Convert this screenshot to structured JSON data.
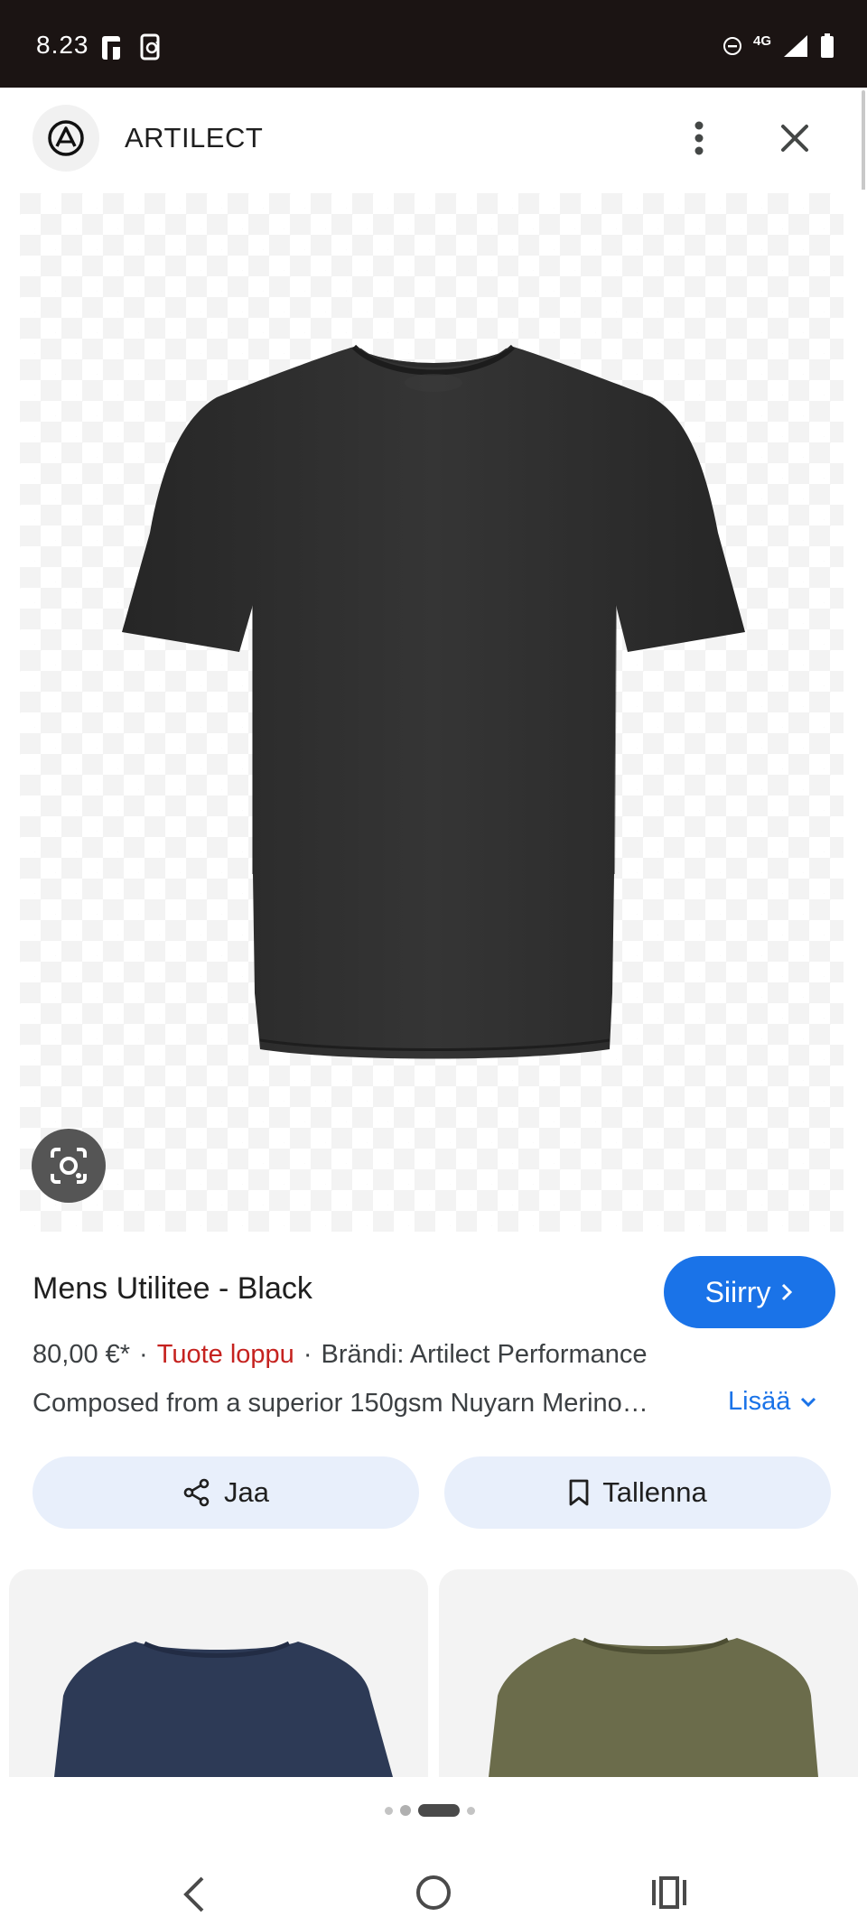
{
  "status_bar": {
    "time": "8.23",
    "network": "4G"
  },
  "header": {
    "site_name": "ARTILECT"
  },
  "product": {
    "title": "Mens Utilitee - Black",
    "go_button_label": "Siirry",
    "price": "80,00 €*",
    "stock_status": "Tuote loppu",
    "brand": "Brändi: Artilect Performance",
    "description": "Composed from a superior 150gsm Nuyarn Merino…",
    "more_label": "Lisää",
    "product_color": "#2f2f2f"
  },
  "actions": {
    "share_label": "Jaa",
    "save_label": "Tallenna"
  },
  "related": {
    "items": [
      {
        "color": "#2d3a56",
        "icon": "navy-tshirt-thumbnail"
      },
      {
        "color": "#6b6c4b",
        "icon": "olive-tshirt-thumbnail"
      }
    ]
  },
  "pager": {
    "pages": 4,
    "current": 3
  },
  "colors": {
    "accent": "#1a73e8",
    "out_of_stock": "#c5221f",
    "chip_background": "#e8effb",
    "status_bar": "#1b1413"
  }
}
